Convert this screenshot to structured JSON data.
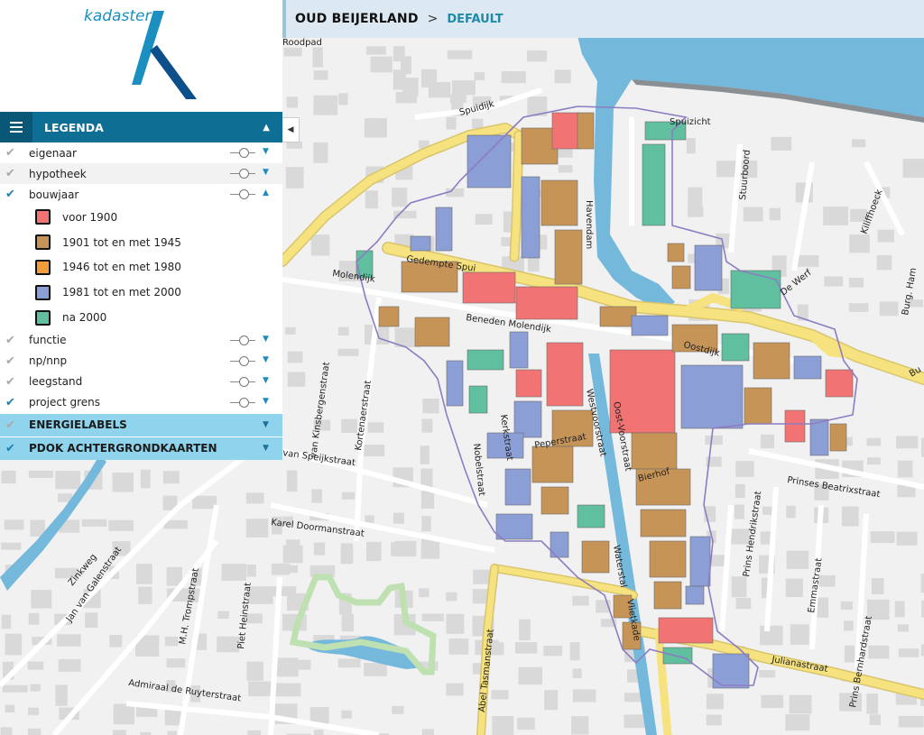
{
  "header": {
    "location": "OUD BEIJERLAND",
    "separator": ">",
    "view": "DEFAULT"
  },
  "logo": {
    "text": "kadaster"
  },
  "legend": {
    "title": "LEGENDA",
    "menu_icon": "hamburger-icon",
    "collapse_icon": "triangle-up-icon",
    "layers": [
      {
        "name": "eigenaar",
        "checked": false,
        "expanded": false
      },
      {
        "name": "hypotheek",
        "checked": false,
        "expanded": false
      },
      {
        "name": "bouwjaar",
        "checked": true,
        "expanded": true
      },
      {
        "name": "functie",
        "checked": false,
        "expanded": false
      },
      {
        "name": "np/nnp",
        "checked": false,
        "expanded": false
      },
      {
        "name": "leegstand",
        "checked": false,
        "expanded": false
      },
      {
        "name": "project grens",
        "checked": true,
        "expanded": false
      }
    ],
    "bouwjaar_classes": [
      {
        "label": "voor 1900",
        "color": "#f27373"
      },
      {
        "label": "1901 tot en met 1945",
        "color": "#c79458"
      },
      {
        "label": "1946 tot en met 1980",
        "color": "#f39c3c"
      },
      {
        "label": "1981 tot en met 2000",
        "color": "#8c9ed6"
      },
      {
        "label": "na 2000",
        "color": "#5fbf9f"
      }
    ],
    "groups": [
      {
        "name": "ENERGIELABELS",
        "checked": false
      },
      {
        "name": "PDOK ACHTERGRONDKAARTEN",
        "checked": true
      }
    ]
  },
  "map": {
    "water_color": "#74b9dc",
    "main_road_color": "#f6e27e",
    "street_labels": [
      "Roodpad",
      "Spuidijk",
      "Spuizicht",
      "Havendam",
      "Stuurboord",
      "Kiliffhoeck",
      "Gedempte Spui",
      "Molendijk",
      "De Werf",
      "Burg. Ham",
      "Beneden Molendijk",
      "Oostdijk",
      "Westvoorstraat",
      "Oost-Voorstraat",
      "van Kinsbergenstraat",
      "Kortenaerstraat",
      "Nobelstraat",
      "Kerkstraat",
      "Peperstraat",
      "Bierhof",
      "Prinses Beatrixstraat",
      "Prins Hendrikstraat",
      "Emmastraat",
      "Prins Bernhardstraat",
      "Julianastraat",
      "Waterstal",
      "Vlietkade",
      "Karel Doormanstraat",
      "Abel Tasmanstraat",
      "van Speijkstraat",
      "Zinkweg",
      "Jan van Galenstraat",
      "M.H. Trompstraat",
      "Piet Heinstraat",
      "Admiraal de Ruyterstraat",
      "Bu"
    ]
  }
}
